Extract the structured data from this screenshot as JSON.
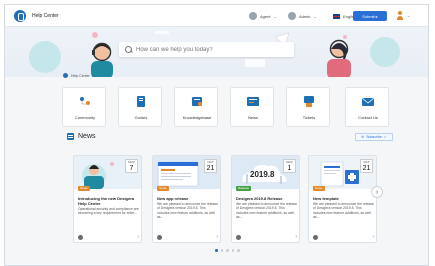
{
  "header": {
    "app_title": "Help Center",
    "agent_label": "Agent",
    "admin_label": "Admin",
    "language_label": "English(en)",
    "submit_label": "Submit ▸",
    "user_caret": "v"
  },
  "search": {
    "placeholder": "How can we help you today?"
  },
  "breadcrumb": {
    "home_label": "Help Center",
    "separator": ">"
  },
  "categories": [
    {
      "label": "Community",
      "icon": "community-icon"
    },
    {
      "label": "Guides",
      "icon": "guides-icon"
    },
    {
      "label": "Knowledgebase",
      "icon": "knowledgebase-icon"
    },
    {
      "label": "News",
      "icon": "news-icon"
    },
    {
      "label": "Tickets",
      "icon": "tickets-icon"
    },
    {
      "label": "Contact Us",
      "icon": "contact-icon"
    }
  ],
  "news": {
    "title": "News",
    "subscribe_label": "Subscribe",
    "next_label": "›",
    "articles": [
      {
        "month": "NOV",
        "day": "7",
        "tag": "News",
        "tag_color": "#e08a2b",
        "title": "Introducing the new Desigera Help Centre",
        "description": "Operational security and compliance are becoming a key requirement for enter...",
        "accent": "#e08a2b"
      },
      {
        "month": "OCT",
        "day": "21",
        "tag": "News",
        "tag_color": "#e08a2b",
        "title": "New app release",
        "description": "We are pleased to announce the release of Desigera version 2019.8. This includes new feature additions, as well as...",
        "accent": "#e08a2b"
      },
      {
        "month": "NOV",
        "day": "1",
        "tag": "Release",
        "tag_color": "#46a046",
        "title": "Desigera 2019.8 Release",
        "description": "We are pleased to announce the release of Desigera version 2019.8. This includes new feature additions, as well as...",
        "accent": "#46a046",
        "banner": "2019.8"
      },
      {
        "month": "OCT",
        "day": "21",
        "tag": "News",
        "tag_color": "#e08a2b",
        "title": "New template",
        "description": "We are pleased to announce the release of Desigera version 2019.8. This includes new feature additions, as well as...",
        "accent": "#e08a2b"
      }
    ]
  },
  "pagination": {
    "active_index": 0,
    "count": 5
  }
}
